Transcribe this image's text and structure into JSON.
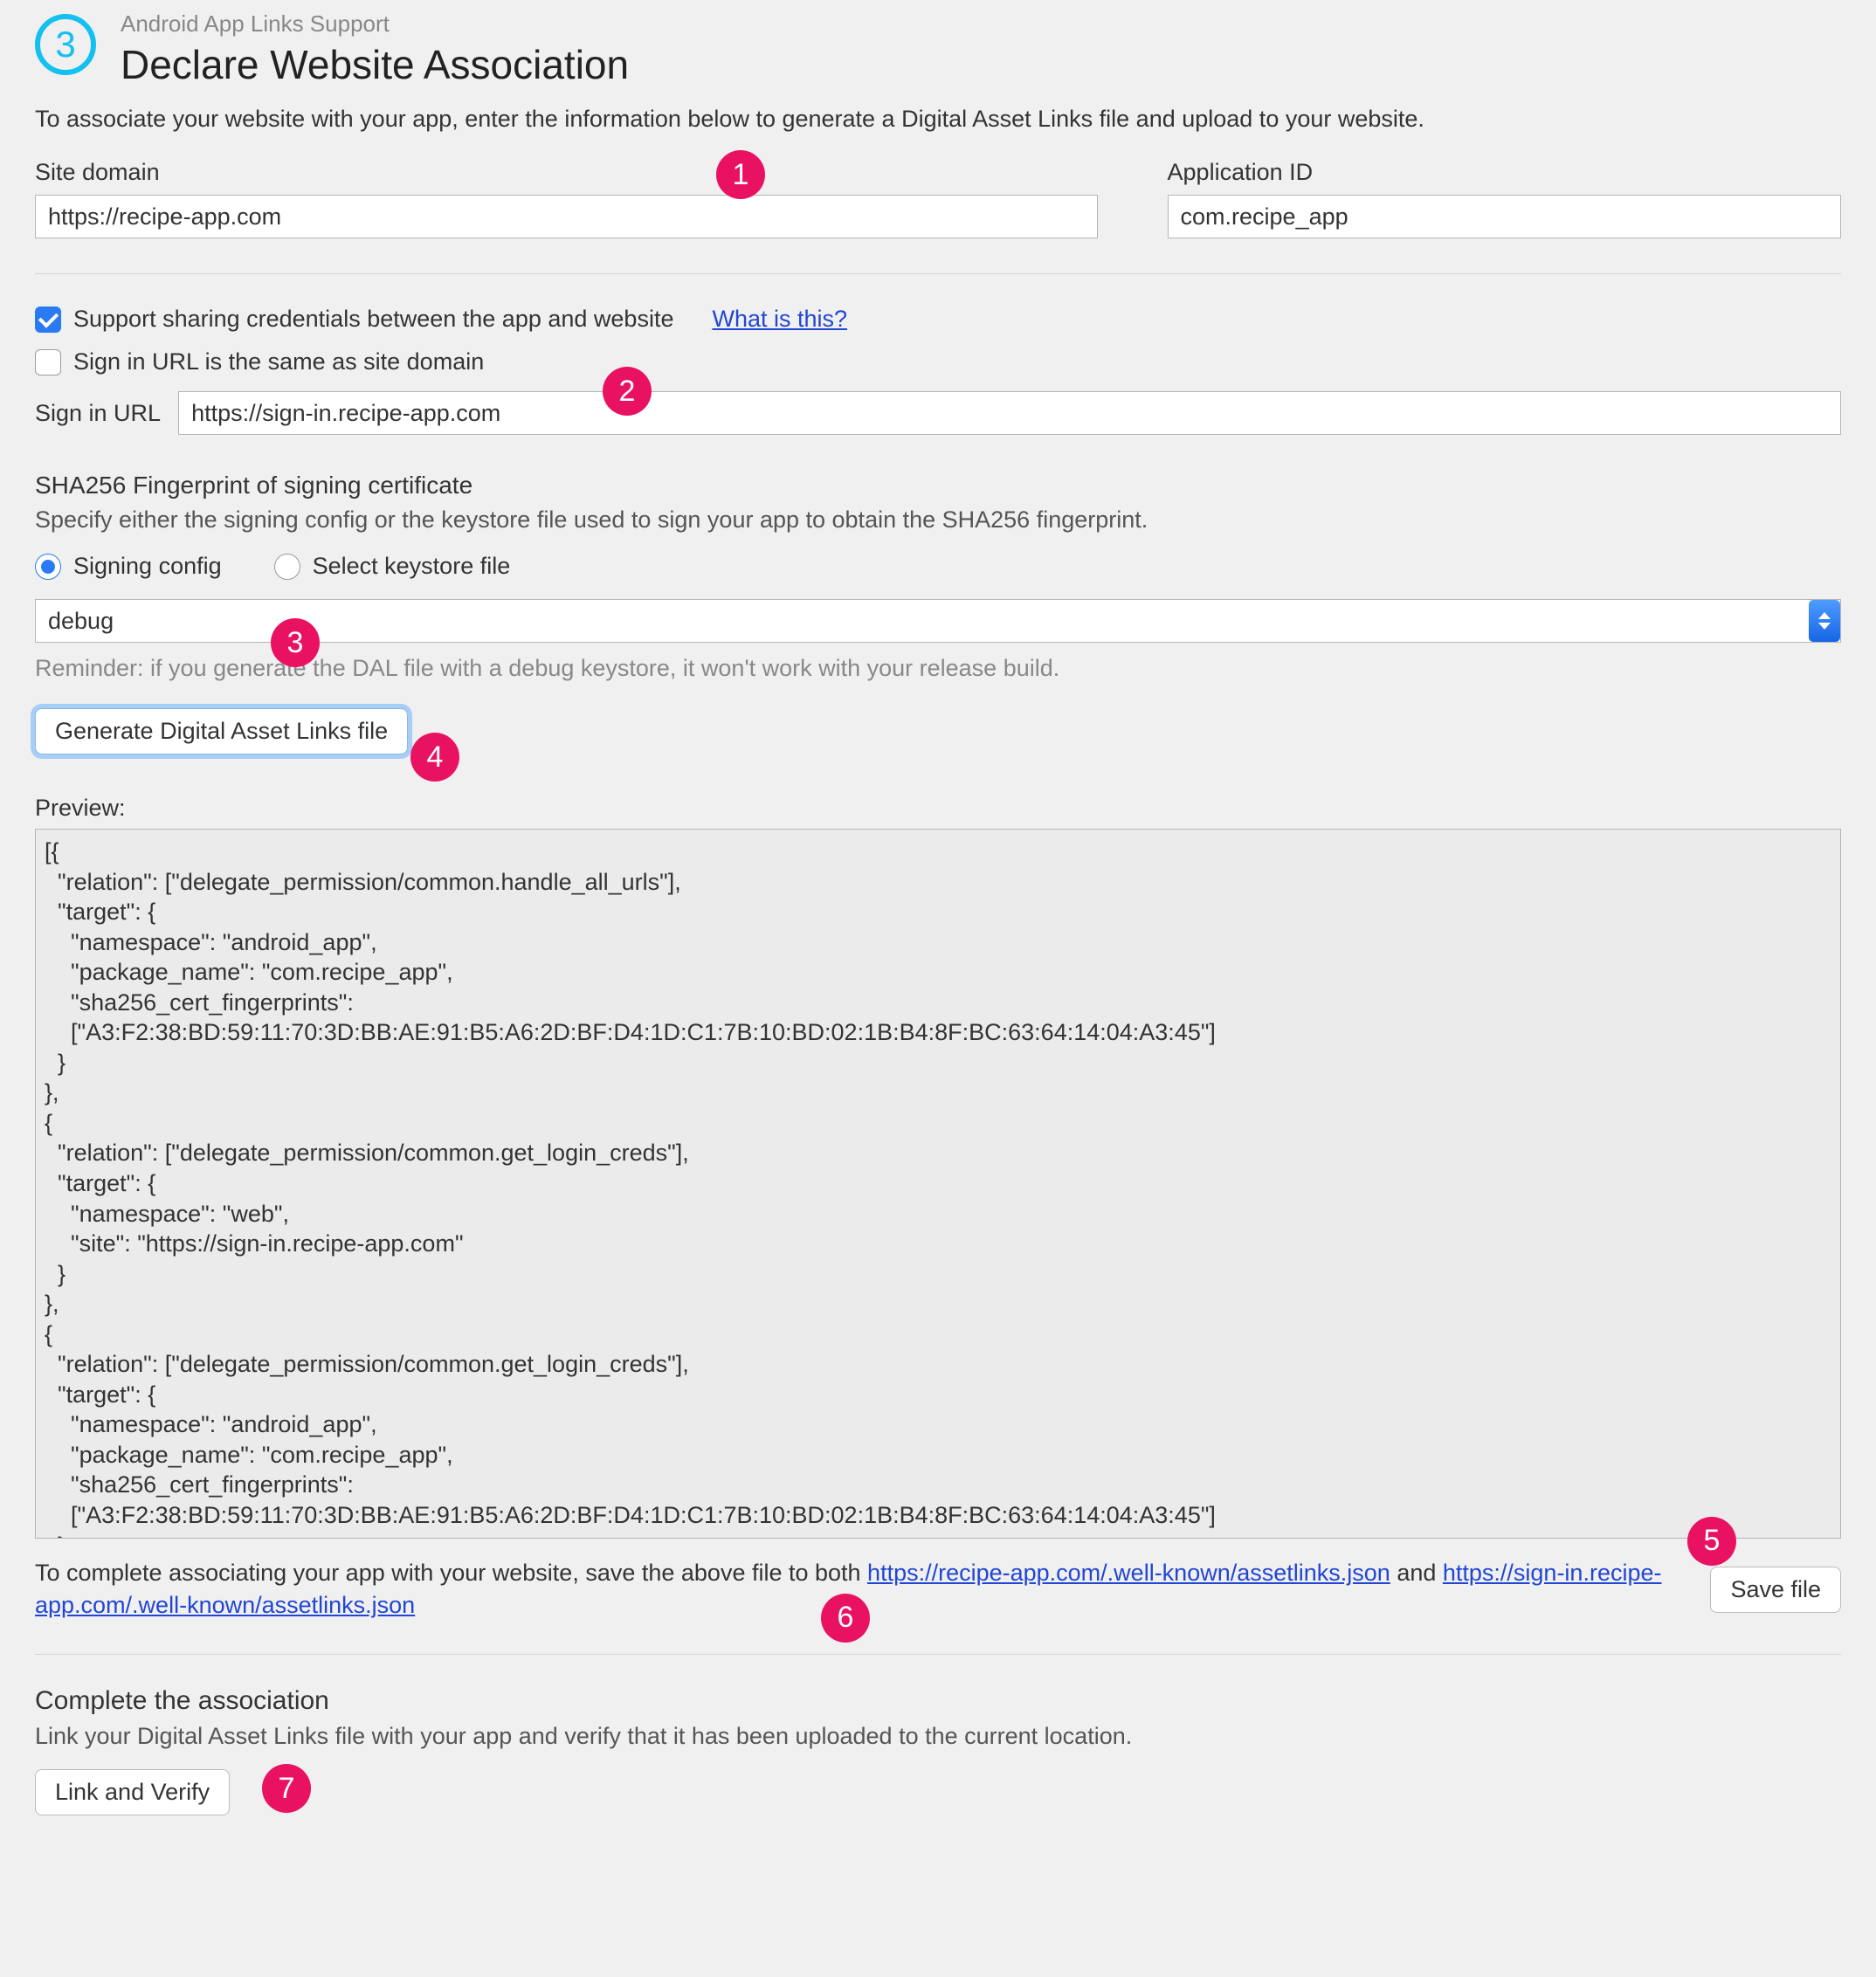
{
  "header": {
    "step_number": "3",
    "subtitle": "Android App Links Support",
    "title": "Declare Website Association"
  },
  "intro": "To associate your website with your app, enter the information below to generate a Digital Asset Links file and upload to your website.",
  "site_domain": {
    "label": "Site domain",
    "value": "https://recipe-app.com"
  },
  "application_id": {
    "label": "Application ID",
    "value": "com.recipe_app"
  },
  "credentials": {
    "support_sharing_label": "Support sharing credentials between the app and website",
    "support_sharing_checked": true,
    "what_is_this": "What is this?",
    "same_as_domain_label": "Sign in URL is the same as site domain",
    "same_as_domain_checked": false,
    "sign_in_label": "Sign in URL",
    "sign_in_value": "https://sign-in.recipe-app.com"
  },
  "sha256": {
    "title": "SHA256 Fingerprint of signing certificate",
    "helper": "Specify either the signing config or the keystore file used to sign your app to obtain the SHA256 fingerprint.",
    "option_signing_config": "Signing config",
    "option_keystore": "Select keystore file",
    "selected_config": "debug",
    "reminder": "Reminder: if you generate the DAL file with a debug keystore, it won't work with your release build."
  },
  "generate_button": "Generate Digital Asset Links file",
  "preview": {
    "label": "Preview:",
    "content": "[{\n  \"relation\": [\"delegate_permission/common.handle_all_urls\"],\n  \"target\": {\n    \"namespace\": \"android_app\",\n    \"package_name\": \"com.recipe_app\",\n    \"sha256_cert_fingerprints\":\n    [\"A3:F2:38:BD:59:11:70:3D:BB:AE:91:B5:A6:2D:BF:D4:1D:C1:7B:10:BD:02:1B:B4:8F:BC:63:64:14:04:A3:45\"]\n  }\n},\n{\n  \"relation\": [\"delegate_permission/common.get_login_creds\"],\n  \"target\": {\n    \"namespace\": \"web\",\n    \"site\": \"https://sign-in.recipe-app.com\"\n  }\n},\n{\n  \"relation\": [\"delegate_permission/common.get_login_creds\"],\n  \"target\": {\n    \"namespace\": \"android_app\",\n    \"package_name\": \"com.recipe_app\",\n    \"sha256_cert_fingerprints\":\n    [\"A3:F2:38:BD:59:11:70:3D:BB:AE:91:B5:A6:2D:BF:D4:1D:C1:7B:10:BD:02:1B:B4:8F:BC:63:64:14:04:A3:45\"]\n  }\n}]"
  },
  "save_instructions": {
    "pre": "To complete associating your app with your website, save the above file to both ",
    "link1": "https://recipe-app.com/.well-known/assetlinks.json",
    "mid": " and ",
    "link2": "https://sign-in.recipe-app.com/.well-known/assetlinks.json",
    "save_button": "Save file"
  },
  "association": {
    "title": "Complete the association",
    "desc": "Link your Digital Asset Links file with your app and verify that it has been uploaded to the current location.",
    "button": "Link and Verify"
  },
  "callouts": {
    "1": "1",
    "2": "2",
    "3": "3",
    "4": "4",
    "5": "5",
    "6": "6",
    "7": "7"
  }
}
